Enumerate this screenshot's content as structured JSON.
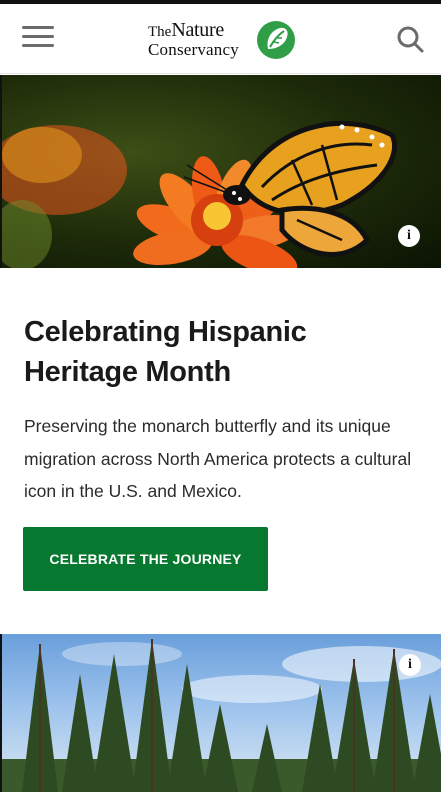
{
  "header": {
    "menu_icon": "hamburger-menu-icon",
    "logo": {
      "line1_small": "The",
      "line1_big": "Nature",
      "line2": "Conservancy"
    },
    "search_icon": "search-icon"
  },
  "hero": {
    "image": "monarch-butterfly-on-orange-zinnia",
    "info_label": "i"
  },
  "feature": {
    "title": "Celebrating Hispanic Heritage Month",
    "description": "Preserving the monarch butterfly and its unique migration across North America protects a cultural icon in the U.S. and Mexico.",
    "cta_label": "CELEBRATE THE JOURNEY"
  },
  "second_hero": {
    "image": "pine-forest-under-blue-sky",
    "info_label": "i"
  },
  "colors": {
    "brand_green": "#06782f",
    "text_dark": "#1a1a1a",
    "icon_gray": "#6b6b6b"
  }
}
